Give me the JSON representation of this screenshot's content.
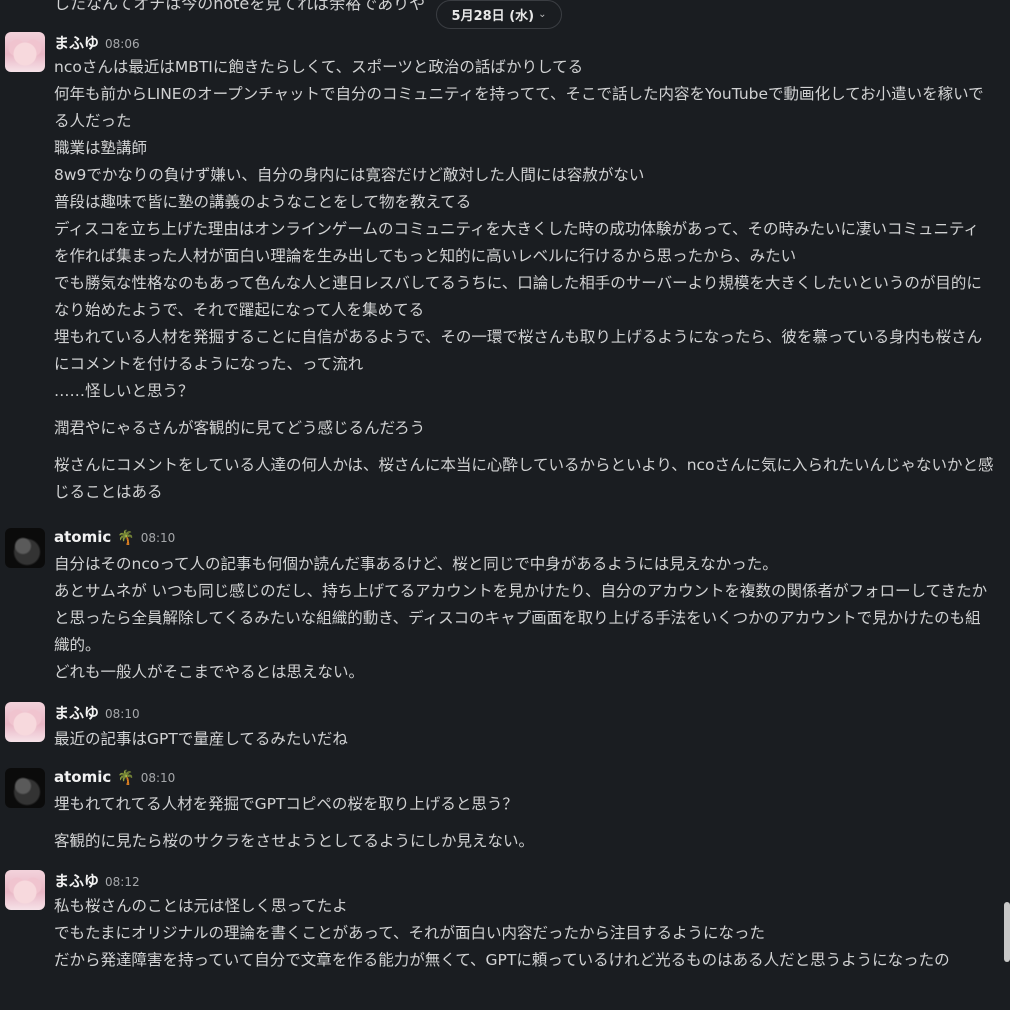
{
  "top_partial_text": "したなんてオチは今のnoteを見てれば余裕でありや",
  "date_divider": "5月28日 (水)",
  "messages": [
    {
      "author": "まふゆ",
      "time": "08:06",
      "paragraphs": [
        "ncoさんは最近はMBTIに飽きたらしくて、スポーツと政治の話ばかりしてる",
        "何年も前からLINEのオープンチャットで自分のコミュニティを持ってて、そこで話した内容をYouTubeで動画化してお小遣いを稼いでる人だった",
        "職業は塾講師",
        "8w9でかなりの負けず嫌い、自分の身内には寛容だけど敵対した人間には容赦がない",
        "普段は趣味で皆に塾の講義のようなことをして物を教えてる",
        "ディスコを立ち上げた理由はオンラインゲームのコミュニティを大きくした時の成功体験があって、その時みたいに凄いコミュニティを作れば集まった人材が面白い理論を生み出してもっと知的に高いレベルに行けるから思ったから、みたい",
        "でも勝気な性格なのもあって色んな人と連日レスバしてるうちに、口論した相手のサーバーより規模を大きくしたいというのが目的になり始めたようで、それで躍起になって人を集めてる",
        "埋もれている人材を発掘することに自信があるようで、その一環で桜さんも取り上げるようになったら、彼を慕っている身内も桜さんにコメントを付けるようになった、って流れ",
        "……怪しいと思う？",
        "潤君やにゃるさんが客観的に見てどう感じるんだろう",
        "桜さんにコメントをしている人達の何人かは、桜さんに本当に心酔しているからといより、ncoさんに気に入られたいんじゃないかと感じることはある"
      ]
    },
    {
      "author": "atomic",
      "badge": "🌴",
      "time": "08:10",
      "paragraphs": [
        "自分はそのncoって人の記事も何個か読んだ事あるけど、桜と同じで中身があるようには見えなかった。",
        "あとサムネが いつも同じ感じのだし、持ち上げてるアカウントを見かけたり、自分のアカウントを複数の関係者がフォローしてきたかと思ったら全員解除してくるみたいな組織的動き、ディスコのキャプ画面を取り上げる手法をいくつかのアカウントで見かけたのも組織的。",
        "どれも一般人がそこまでやるとは思えない。"
      ]
    },
    {
      "author": "まふゆ",
      "time": "08:10",
      "paragraphs": [
        "最近の記事はGPTで量産してるみたいだね"
      ]
    },
    {
      "author": "atomic",
      "badge": "🌴",
      "time": "08:10",
      "paragraphs": [
        "埋もれてれてる人材を発掘でGPTコピペの桜を取り上げると思う？",
        "客観的に見たら桜のサクラをさせようとしてるようにしか見えない。"
      ]
    },
    {
      "author": "まふゆ",
      "time": "08:12",
      "paragraphs": [
        "私も桜さんのことは元は怪しく思ってたよ",
        "でもたまにオリジナルの理論を書くことがあって、それが面白い内容だったから注目するようになった",
        "だから発達障害を持っていて自分で文章を作る能力が無くて、GPTに頼っているけれど光るものはある人だと思うようになったの"
      ]
    }
  ]
}
